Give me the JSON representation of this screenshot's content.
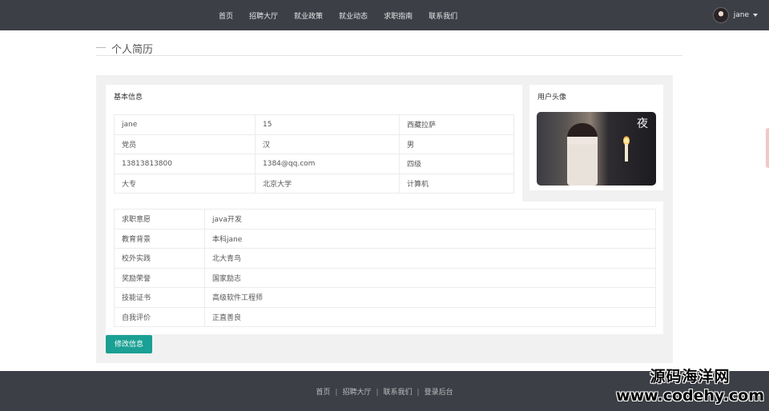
{
  "nav": {
    "links": [
      "首页",
      "招聘大厅",
      "就业政策",
      "就业动态",
      "求职指南",
      "联系我们"
    ],
    "user": "jane"
  },
  "page": {
    "title": "个人简历"
  },
  "basic": {
    "title": "基本信息",
    "rows": [
      [
        "jane",
        "15",
        "西藏拉萨"
      ],
      [
        "党员",
        "汉",
        "男"
      ],
      [
        "13813813800",
        "1384@qq.com",
        "四级"
      ],
      [
        "大专",
        "北京大学",
        "计算机"
      ]
    ]
  },
  "avatar": {
    "title": "用户头像",
    "glyph": "夜"
  },
  "detail": {
    "rows": [
      [
        "求职意愿",
        "java开发"
      ],
      [
        "教育背景",
        "本科jane"
      ],
      [
        "校外实践",
        "北大青鸟"
      ],
      [
        "奖励荣誉",
        "国家励志"
      ],
      [
        "技能证书",
        "高级软件工程师"
      ],
      [
        "自我评价",
        "正直善良"
      ]
    ]
  },
  "actions": {
    "edit_label": "修改信息"
  },
  "footer": {
    "links": [
      "首页",
      "招聘大厅",
      "联系我们",
      "登录后台"
    ]
  },
  "watermark": {
    "line1": "源码海洋网",
    "line2": "www.codehy.com"
  },
  "colors": {
    "nav_bg": "#3d3f47",
    "accent": "#1aa094",
    "panel_bg": "#f1f1f1"
  }
}
